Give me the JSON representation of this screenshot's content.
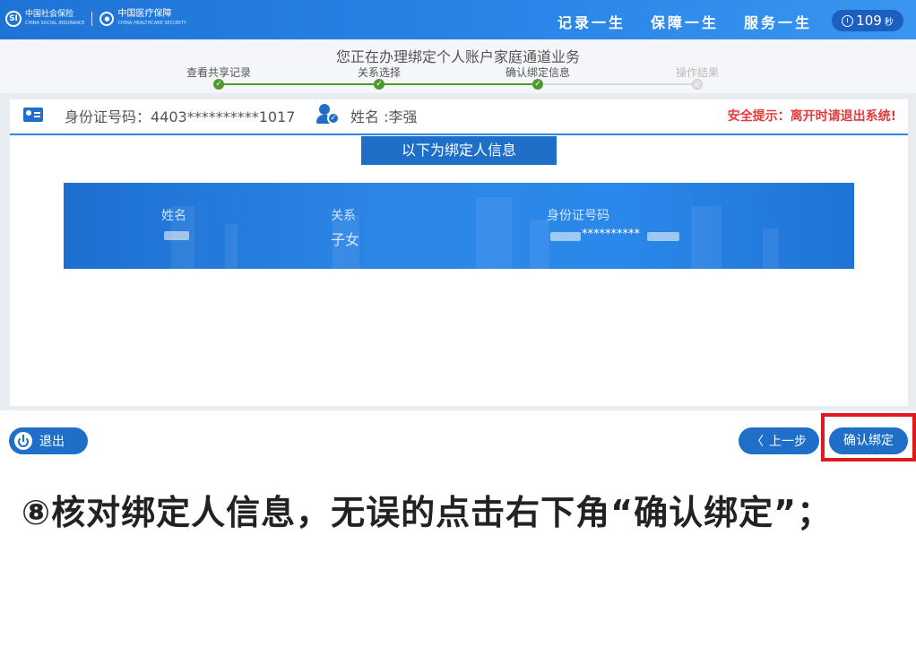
{
  "header": {
    "logo_si_mark": "SI",
    "logo_si_cn": "中国社会保险",
    "logo_si_en": "CHINA SOCIAL INSURANCE",
    "logo_hs_mark": "●",
    "logo_hs_cn": "中国医疗保障",
    "logo_hs_en": "CHINA HEALTHCARE SECURITY",
    "slogan_1": "记录一生",
    "slogan_2": "保障一生",
    "slogan_3": "服务一生",
    "timer_value": "109",
    "timer_unit": "秒"
  },
  "steps": {
    "title": "您正在办理绑定个人账户家庭通道业务",
    "items": [
      {
        "label": "查看共享记录",
        "done": true
      },
      {
        "label": "关系选择",
        "done": true
      },
      {
        "label": "确认绑定信息",
        "done": true
      },
      {
        "label": "操作结果",
        "done": false
      }
    ],
    "check_mark": "✓"
  },
  "info": {
    "id_label": "身份证号码：4403**********1017",
    "name_label": "姓名 :李强",
    "check_mark": "✓",
    "warning": "安全提示：离开时请退出系统!"
  },
  "binding": {
    "section_title": "以下为绑定人信息",
    "col_name_label": "姓名",
    "col_relation_label": "关系",
    "col_relation_value": "子女",
    "col_id_label": "身份证号码",
    "col_id_value": "**********"
  },
  "buttons": {
    "exit": "退出",
    "prev_arrow": "〈",
    "prev": "上一步",
    "confirm": "确认绑定"
  },
  "caption": "⑧核对绑定人信息，无误的点击右下角“确认绑定”；",
  "colors": {
    "primary": "#1f6fc9",
    "step_done": "#4e9a2e",
    "warning": "#e23c3c",
    "highlight": "#e0181f"
  }
}
